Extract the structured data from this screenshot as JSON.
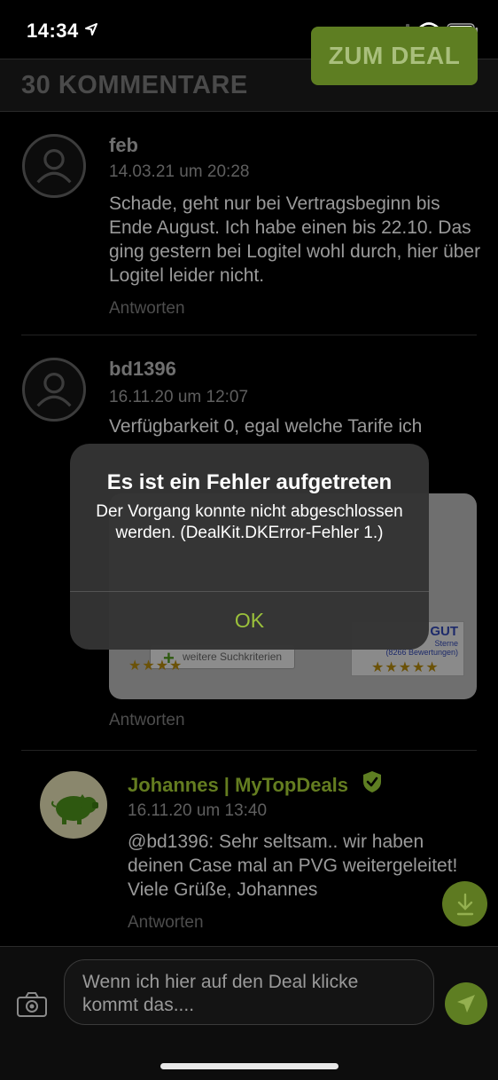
{
  "status_bar": {
    "time": "14:34"
  },
  "header": {
    "title": "30 KOMMENTARE",
    "deal_button": "ZUM DEAL"
  },
  "comments": [
    {
      "name": "feb",
      "date": "14.03.21 um 20:28",
      "text": "Schade, geht nur bei Vertragsbeginn bis Ende August. Ich habe einen bis 22.10. Das ging gestern bei Logitel wohl durch, hier über Logitel leider nicht.",
      "reply": "Antworten"
    },
    {
      "name": "bd1396",
      "date": "16.11.20 um 12:07",
      "text": "Verfügbarkeit 0, egal welche Tarife ich",
      "reply": "Antworten",
      "image": {
        "button": "weitere Suchkriterien",
        "badge_title": "GUT",
        "badge_line1": "Sterne",
        "badge_line2": "(8266 Bewertungen)"
      }
    }
  ],
  "staff_reply": {
    "name": "Johannes | MyTopDeals",
    "date": "16.11.20 um 13:40",
    "text": "@bd1396: Sehr seltsam.. wir haben deinen Case mal an PVG weitergeleitet! Viele Grüße, Johannes",
    "reply": "Antworten"
  },
  "composer": {
    "text": "Wenn ich hier auf den Deal klicke kommt das...."
  },
  "alert": {
    "title": "Es ist ein Fehler aufgetreten",
    "message": "Der Vorgang konnte nicht abgeschlossen werden. (DealKit.DKError-Fehler 1.)",
    "ok": "OK"
  },
  "colors": {
    "accent": "#5e7e22",
    "accent_text": "#9bc13b",
    "background": "#000000",
    "alert_bg": "#343434"
  }
}
